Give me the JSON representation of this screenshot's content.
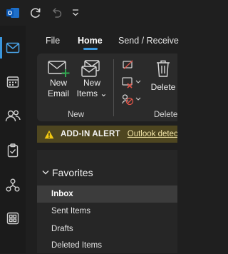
{
  "titlebar": {
    "icons": [
      "outlook-logo-icon",
      "sync-icon",
      "undo-icon",
      "customize-quick-access-icon"
    ],
    "app_badge": "O"
  },
  "rail": {
    "items": [
      "mail-icon",
      "calendar-icon",
      "people-icon",
      "tasks-icon",
      "org-explorer-icon",
      "apps-icon"
    ],
    "active": "mail-icon"
  },
  "menu": {
    "tabs": [
      "File",
      "Home",
      "Send / Receive"
    ],
    "active_tab": "Home"
  },
  "ribbon": {
    "new_email": {
      "line1": "New",
      "line2": "Email"
    },
    "new_items": {
      "line1": "New",
      "line2": "Items",
      "caret": "⌄"
    },
    "group_new": "New",
    "delete_label": "Delete",
    "group_delete": "Delete"
  },
  "alert": {
    "title": "ADD-IN ALERT",
    "link": "Outlook detected"
  },
  "folders": {
    "header": "Favorites",
    "items": [
      "Inbox",
      "Sent Items",
      "Drafts",
      "Deleted Items"
    ],
    "selected": "Inbox"
  },
  "colors": {
    "accent": "#3a96dd",
    "alert_background": "#4e4620",
    "alert_icon": "#f2c811",
    "new_plus": "#2fa84f",
    "delete_x": "#e0554a"
  }
}
